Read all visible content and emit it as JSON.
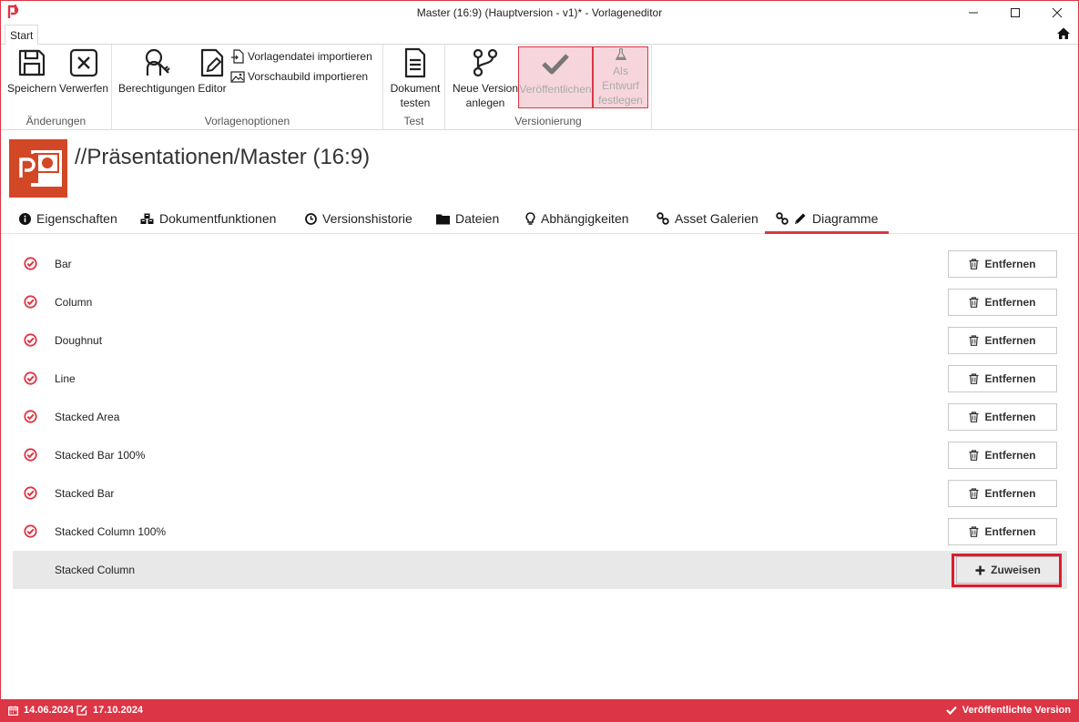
{
  "window": {
    "title": "Master (16:9) (Hauptversion - v1)* - Vorlageneditor",
    "minimize_label": "—",
    "maximize_label": "☐",
    "close_label": "✕"
  },
  "ribbon_tabs": [
    {
      "label": "Start"
    }
  ],
  "ribbon": {
    "groups": [
      {
        "label": "Änderungen"
      },
      {
        "label": "Vorlagenoptionen"
      },
      {
        "label": "Test"
      },
      {
        "label": "Versionierung"
      }
    ],
    "save": "Speichern",
    "discard": "Verwerfen",
    "permissions": "Berechtigungen",
    "editor": "Editor",
    "import_template": "Vorlagendatei importieren",
    "import_preview": "Vorschaubild importieren",
    "test_line1": "Dokument",
    "test_line2": "testen",
    "newversion_line1": "Neue Version",
    "newversion_line2": "anlegen",
    "publish": "Veröffentlichen",
    "draft_line1": "Als Entwurf",
    "draft_line2": "festlegen"
  },
  "header": {
    "title": "//Präsentationen/Master (16:9)"
  },
  "tabs": [
    {
      "label": "Eigenschaften",
      "icon": "info-circle-icon"
    },
    {
      "label": "Dokumentfunktionen",
      "icon": "cubes-icon"
    },
    {
      "label": "Versionshistorie",
      "icon": "clock-icon"
    },
    {
      "label": "Dateien",
      "icon": "folder-icon"
    },
    {
      "label": "Abhängigkeiten",
      "icon": "lightbulb-icon"
    },
    {
      "label": "Asset Galerien",
      "icon": "link-icon"
    },
    {
      "label": "Diagramme",
      "icon": "pencil-icon"
    }
  ],
  "charts": [
    {
      "label": "Bar",
      "action": "Entfernen",
      "assigned": true
    },
    {
      "label": "Column",
      "action": "Entfernen",
      "assigned": true
    },
    {
      "label": "Doughnut",
      "action": "Entfernen",
      "assigned": true
    },
    {
      "label": "Line",
      "action": "Entfernen",
      "assigned": true
    },
    {
      "label": "Stacked Area",
      "action": "Entfernen",
      "assigned": true
    },
    {
      "label": "Stacked Bar 100%",
      "action": "Entfernen",
      "assigned": true
    },
    {
      "label": "Stacked Bar",
      "action": "Entfernen",
      "assigned": true
    },
    {
      "label": "Stacked Column 100%",
      "action": "Entfernen",
      "assigned": true
    },
    {
      "label": "Stacked Column",
      "action": "Zuweisen",
      "assigned": false
    }
  ],
  "statusbar": {
    "created": "14.06.2024",
    "modified": "17.10.2024",
    "status": "Veröffentlichte Version"
  },
  "colors": {
    "accent": "#dc3545",
    "ppt": "#d24726"
  }
}
